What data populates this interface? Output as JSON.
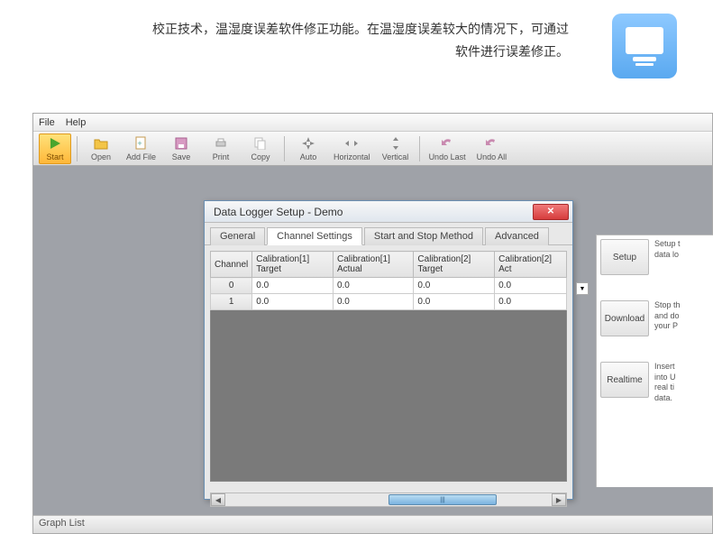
{
  "header": {
    "line1": "校正技术，温湿度误差软件修正功能。在温湿度误差较大的情况下，可通过",
    "line2": "软件进行误差修正。"
  },
  "menu": {
    "file": "File",
    "help": "Help"
  },
  "toolbar": {
    "start": "Start",
    "open": "Open",
    "addfile": "Add File",
    "save": "Save",
    "print": "Print",
    "copy": "Copy",
    "auto": "Auto",
    "horizontal": "Horizontal",
    "vertical": "Vertical",
    "undolast": "Undo Last",
    "undoall": "Undo All"
  },
  "statusbar": {
    "text": "Graph List"
  },
  "dialog": {
    "title": "Data Logger Setup - Demo",
    "tabs": {
      "general": "General",
      "channel": "Channel Settings",
      "startstop": "Start and Stop Method",
      "advanced": "Advanced"
    },
    "columns": [
      "Channel",
      "Calibration[1] Target",
      "Calibration[1] Actual",
      "Calibration[2] Target",
      "Calibration[2] Act"
    ],
    "rows": [
      {
        "ch": "0",
        "c1t": "0.0",
        "c1a": "0.0",
        "c2t": "0.0",
        "c2a": "0.0"
      },
      {
        "ch": "1",
        "c1t": "0.0",
        "c1a": "0.0",
        "c2t": "0.0",
        "c2a": "0.0"
      }
    ],
    "thumb": "|||"
  },
  "side": {
    "setup": {
      "label": "Setup",
      "desc": "Setup t\ndata lo"
    },
    "download": {
      "label": "Download",
      "desc": "Stop th\nand do\nyour P"
    },
    "realtime": {
      "label": "Realtime",
      "desc": "Insert\ninto U\nreal ti\ndata."
    }
  }
}
